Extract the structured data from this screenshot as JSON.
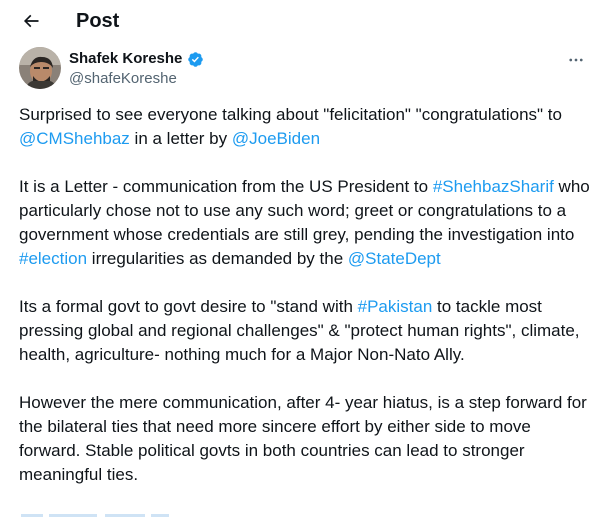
{
  "header": {
    "title": "Post",
    "back_icon": "arrow-left-icon"
  },
  "author": {
    "name": "Shafek Koreshe",
    "handle": "@shafeKoreshe",
    "verified_icon": "verified-badge-icon",
    "more_icon": "more-horizontal-icon"
  },
  "tweet": {
    "p1": {
      "t1": "Surprised to see everyone talking about \"felicitation\" \"congratulations\" to ",
      "l1": "@CMShehbaz",
      "t2": " in a letter by ",
      "l2": "@JoeBiden"
    },
    "p2": {
      "t1": "It is a Letter - communication from the US President to ",
      "l1": "#ShehbazSharif",
      "t2": " who particularly chose not to use any such word; greet or congratulations to a government whose credentials are still grey, pending the investigation into ",
      "l2": "#election",
      "t3": " irregularities as demanded by the ",
      "l3": "@StateDept"
    },
    "p3": {
      "t1": "Its a formal govt to govt desire to \"stand with ",
      "l1": "#Pakistan",
      "t2": " to tackle most pressing global and regional challenges\" & \"protect human rights\", climate, health, agriculture- nothing much for a Major Non-Nato Ally."
    },
    "p4": {
      "t1": "However the mere communication, after 4- year hiatus, is a step forward for the bilateral ties that need more sincere effort by either side to move forward. Stable political govts in both countries can lead to stronger meaningful ties."
    }
  },
  "colors": {
    "text": "#0f1419",
    "secondary": "#536471",
    "link": "#1d9bf0",
    "verified": "#1d9bf0"
  }
}
